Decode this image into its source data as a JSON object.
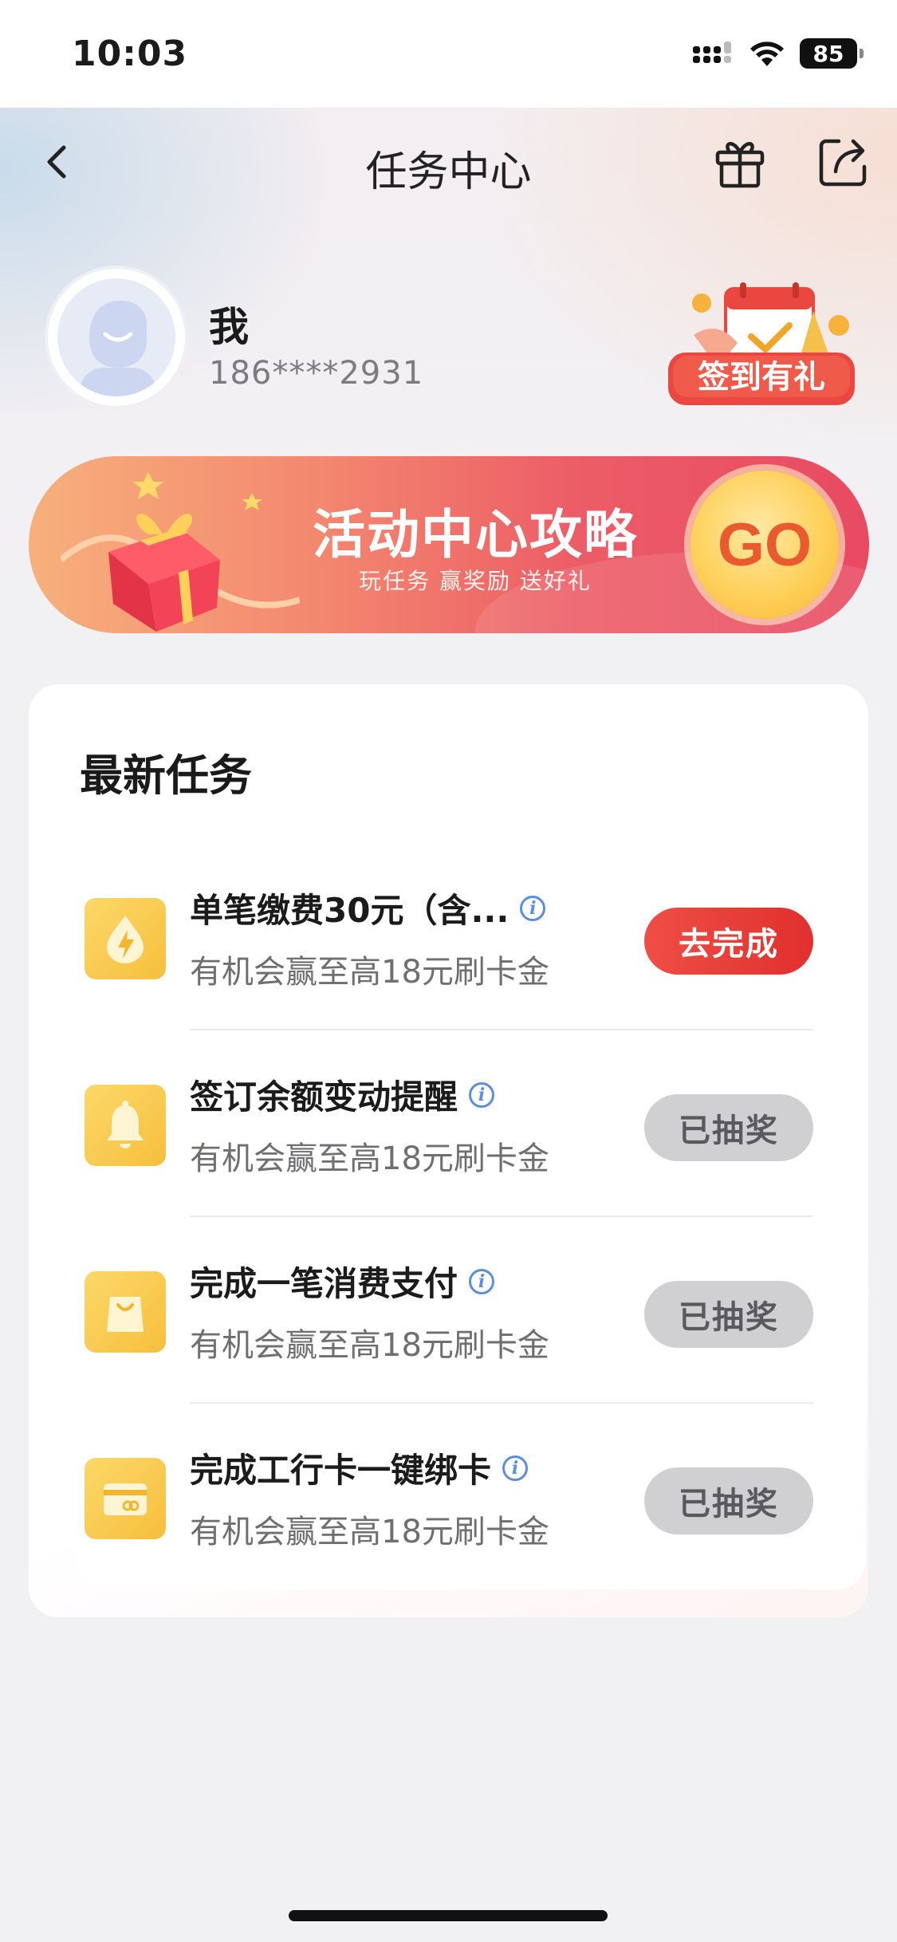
{
  "status_bar": {
    "time": "10:03",
    "battery": "85"
  },
  "nav": {
    "title": "任务中心"
  },
  "profile": {
    "name": "我",
    "phone": "186****2931"
  },
  "checkin_badge": {
    "label": "签到有礼"
  },
  "banner": {
    "title": "活动中心攻略",
    "subtitle": "玩任务 赢奖励 送好礼",
    "go_label": "GO"
  },
  "tasks_section": {
    "title": "最新任务",
    "items": [
      {
        "name": "单笔缴费30元（含...",
        "desc": "有机会赢至高18元刷卡金",
        "button": "去完成",
        "state": "active",
        "icon": "flame-drop-icon"
      },
      {
        "name": "签订余额变动提醒",
        "desc": "有机会赢至高18元刷卡金",
        "button": "已抽奖",
        "state": "done",
        "icon": "bell-icon"
      },
      {
        "name": "完成一笔消费支付",
        "desc": "有机会赢至高18元刷卡金",
        "button": "已抽奖",
        "state": "done",
        "icon": "shopping-bag-icon"
      },
      {
        "name": "完成工行卡一键绑卡",
        "desc": "有机会赢至高18元刷卡金",
        "button": "已抽奖",
        "state": "done",
        "icon": "card-link-icon"
      }
    ]
  },
  "colors": {
    "accent_red": "#e0302f",
    "icon_yellow": "#f6bf3c",
    "done_gray": "#d0d0d2"
  }
}
